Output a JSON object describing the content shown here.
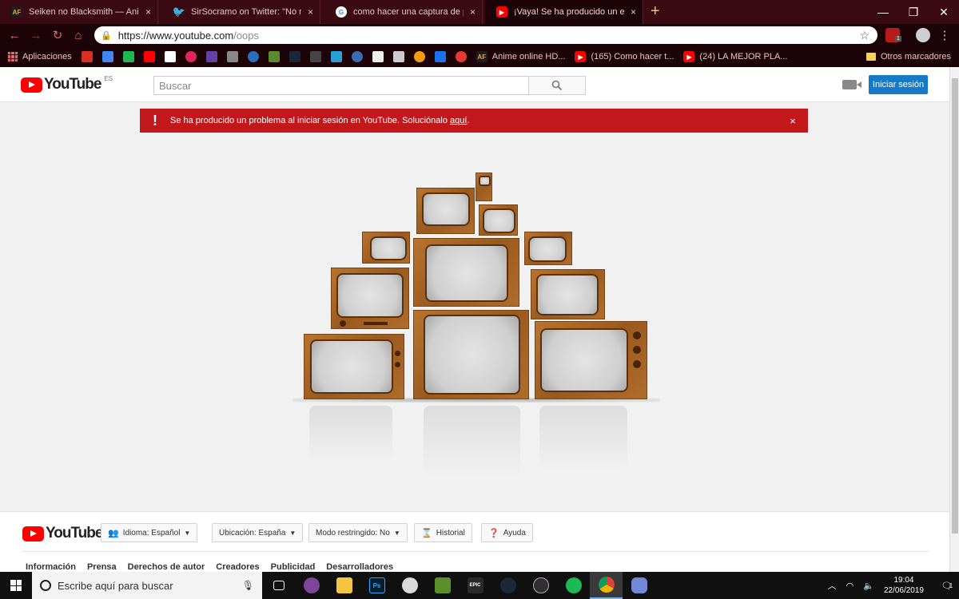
{
  "browser": {
    "tabs": [
      {
        "title": "Seiken no Blacksmith — AnimeF",
        "favicon": "af-icon",
        "active": false
      },
      {
        "title": "SirSocramo on Twitter: \"No me d",
        "favicon": "twitter-icon",
        "active": false
      },
      {
        "title": "como hacer una captura de pant",
        "favicon": "google-icon",
        "active": false
      },
      {
        "title": "¡Vaya! Se ha producido un error",
        "favicon": "youtube-icon",
        "active": true
      }
    ],
    "url_host": "https://www.youtube.com",
    "url_path": "/oops",
    "bookmarks": {
      "apps_label": "Aplicaciones",
      "anime_label": "Anime online HD...",
      "yt1_label": "(165) Como hacer t...",
      "yt2_label": "(24) LA MEJOR PLA...",
      "more": "»",
      "other_label": "Otros marcadores"
    },
    "ext_badge": "1"
  },
  "youtube": {
    "logo_text": "YouTube",
    "region": "ES",
    "search_placeholder": "Buscar",
    "signin_label": "Iniciar sesión",
    "alert": {
      "icon": "!",
      "text": "Se ha producido un problema al iniciar sesión en YouTube. Soluciónalo ",
      "link": "aquí",
      "tail": ".",
      "close": "×"
    },
    "footer": {
      "language": "Idioma: Español",
      "location": "Ubicación: España",
      "restricted": "Modo restringido: No",
      "history": "Historial",
      "help": "Ayuda",
      "links": [
        "Información",
        "Prensa",
        "Derechos de autor",
        "Creadores",
        "Publicidad",
        "Desarrolladores"
      ]
    }
  },
  "taskbar": {
    "search_placeholder": "Escribe aquí para buscar",
    "time": "19:04",
    "date": "22/06/2019",
    "notif_count": "1"
  },
  "colors": {
    "alert_red": "#c2181c",
    "youtube_red": "#ff0000",
    "signin_blue": "#167ac6",
    "chrome_theme": "#3a0a12"
  }
}
